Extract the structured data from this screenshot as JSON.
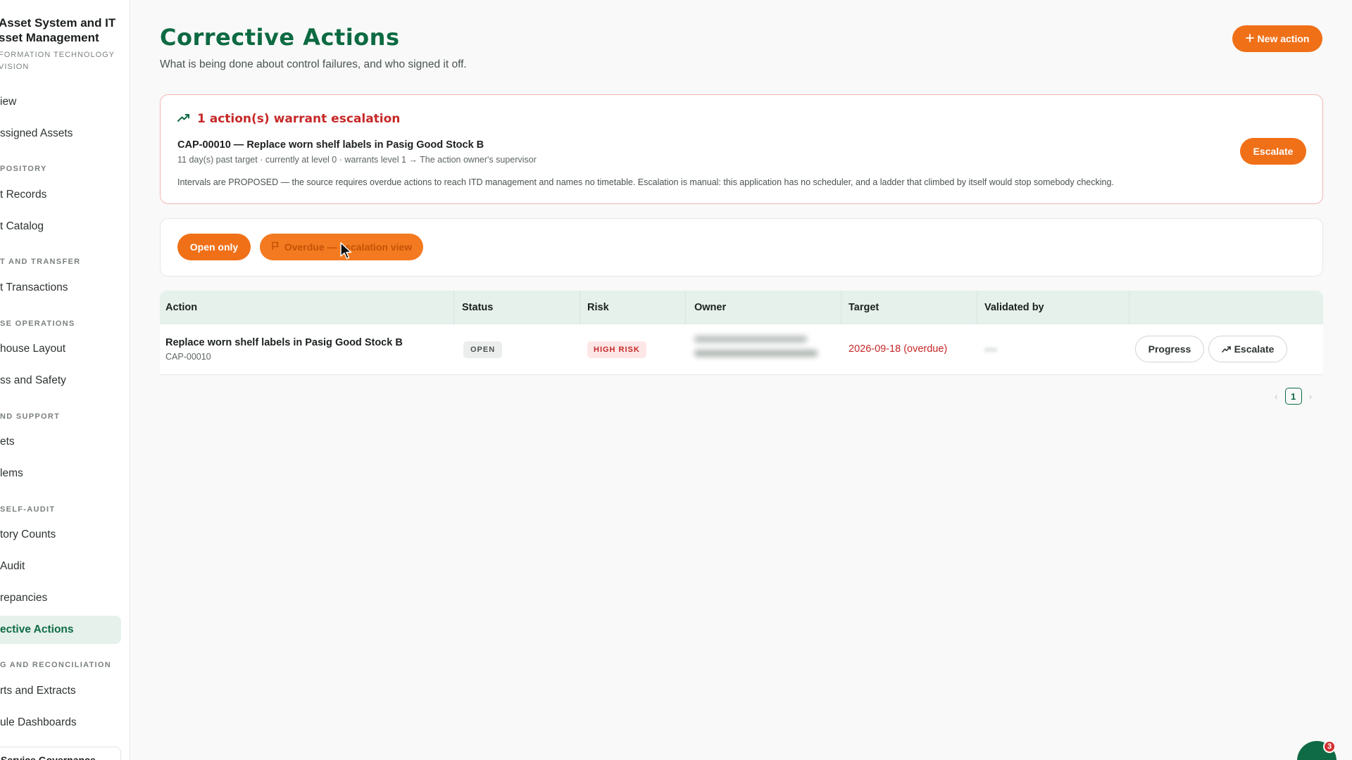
{
  "brand": {
    "title_line1": "Asset System and IT",
    "title_line2": "sset Management",
    "sub_line1": "FORMATION TECHNOLOGY",
    "sub_line2": "VISION"
  },
  "sidebar": {
    "items": [
      {
        "label": "iew"
      },
      {
        "label": "ssigned Assets"
      },
      {
        "label": "t Records"
      },
      {
        "label": "t Catalog"
      },
      {
        "label": "t Transactions"
      },
      {
        "label": "house Layout"
      },
      {
        "label": "ss and Safety"
      },
      {
        "label": "ets"
      },
      {
        "label": "lems"
      },
      {
        "label": "tory Counts"
      },
      {
        "label": "Audit"
      },
      {
        "label": "repancies"
      },
      {
        "label": "ective Actions"
      },
      {
        "label": "rts and Extracts"
      },
      {
        "label": "ule Dashboards"
      }
    ],
    "sections": [
      {
        "label": "POSITORY"
      },
      {
        "label": "T AND TRANSFER"
      },
      {
        "label": "SE OPERATIONS"
      },
      {
        "label": "ND SUPPORT"
      },
      {
        "label": "SELF-AUDIT"
      },
      {
        "label": "G AND RECONCILIATION"
      }
    ],
    "footer_label": "Service Governance"
  },
  "header": {
    "title": "Corrective Actions",
    "subtitle": "What is being done about control failures, and who signed it off.",
    "new_action_label": "New action",
    "new_action_icon": "plus-icon"
  },
  "escalation": {
    "heading": "1 action(s) warrant escalation",
    "heading_icon": "trending-up-icon",
    "item_title": "CAP-00010 — Replace worn shelf labels in Pasig Good Stock B",
    "item_meta": "11 day(s) past target · currently at level 0 · warrants level 1 → The action owner's supervisor",
    "note": "Intervals are PROPOSED — the source requires overdue actions to reach ITD management and names no timetable. Escalation is manual: this application has no scheduler, and a ladder that climbed by itself would stop somebody checking.",
    "button_label": "Escalate"
  },
  "filters": {
    "open_only_label": "Open only",
    "overdue_label": "Overdue — escalation view",
    "overdue_icon": "flag-icon"
  },
  "table": {
    "columns": [
      "Action",
      "Status",
      "Risk",
      "Owner",
      "Target",
      "Validated by"
    ],
    "rows": [
      {
        "title": "Replace worn shelf labels in Pasig Good Stock B",
        "id": "CAP-00010",
        "status": "OPEN",
        "risk": "HIGH RISK",
        "target": "2026-09-18 (overdue)",
        "progress_label": "Progress",
        "escalate_label": "Escalate"
      }
    ]
  },
  "pagination": {
    "current_page": "1"
  },
  "notifications": {
    "count": "3"
  },
  "colors": {
    "accent": "#f07018",
    "brand_green": "#0d6a42",
    "danger": "#c62828"
  }
}
